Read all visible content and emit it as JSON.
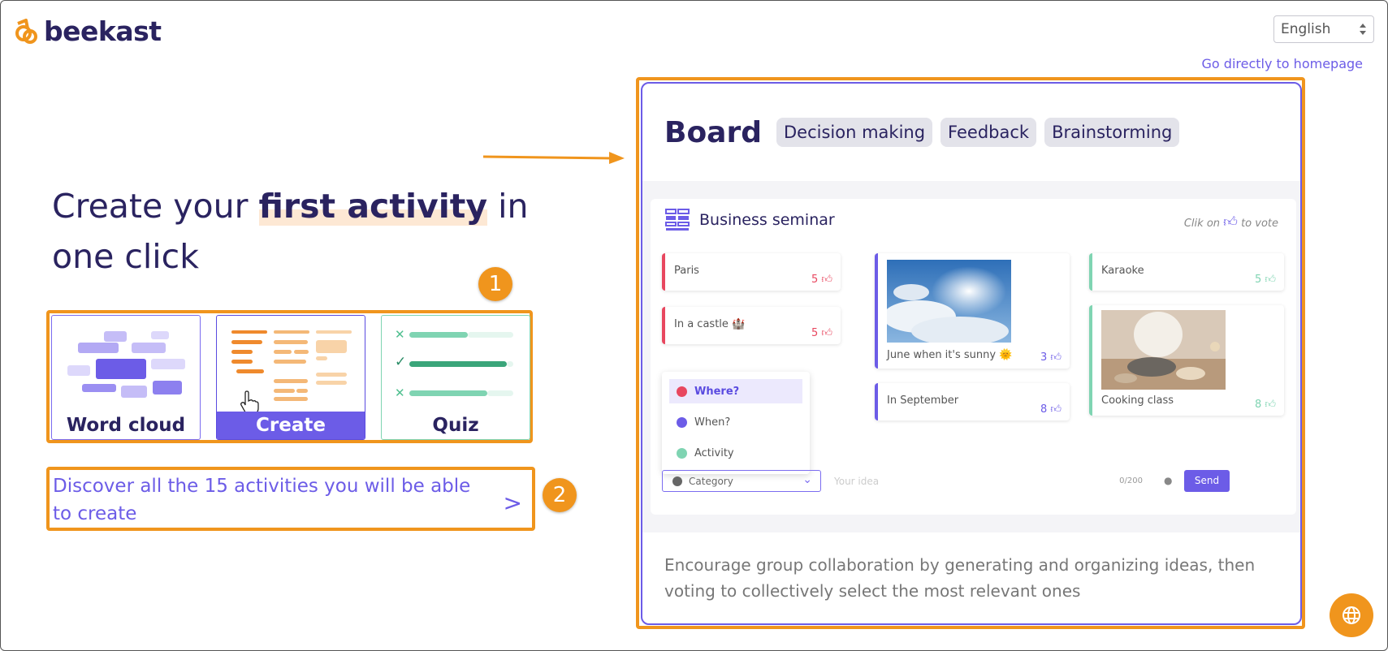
{
  "header": {
    "logo_text": "beekast",
    "language": "English",
    "homepage_link": "Go directly to homepage"
  },
  "hero": {
    "title_part1": "Create your ",
    "title_highlight": "first activity",
    "title_part2": " in one click"
  },
  "badges": {
    "one": "1",
    "two": "2"
  },
  "cards": [
    {
      "label": "Word cloud"
    },
    {
      "label": "Create"
    },
    {
      "label": "Quiz"
    }
  ],
  "discover_link": "Discover all the 15 activities you will be able to create",
  "board": {
    "title": "Board",
    "tags": [
      "Decision making",
      "Feedback",
      "Brainstorming"
    ],
    "session_title": "Business seminar",
    "vote_hint_pre": "Clik on",
    "vote_hint_post": "to vote",
    "notes": [
      {
        "text": "Paris",
        "votes": "5"
      },
      {
        "text": "In a castle 🏰",
        "votes": "5"
      },
      {
        "text": "June when it's sunny 🌞",
        "votes": "3"
      },
      {
        "text": "In September",
        "votes": "8"
      },
      {
        "text": "Karaoke",
        "votes": "5"
      },
      {
        "text": "Cooking class",
        "votes": "8"
      }
    ],
    "categories": [
      {
        "label": "Where?",
        "color": "#e8475f"
      },
      {
        "label": "When?",
        "color": "#6c5ce7"
      },
      {
        "label": "Activity",
        "color": "#7fd4b2"
      }
    ],
    "category_select": "Category",
    "idea_placeholder": "Your idea",
    "char_count": "0/200",
    "send_label": "Send",
    "description": "Encourage group collaboration by generating and organizing ideas, then voting to collectively select the most relevant ones"
  },
  "colors": {
    "accent": "#6c5ce7",
    "highlight_orange": "#f0951d",
    "navy": "#2a2360"
  }
}
